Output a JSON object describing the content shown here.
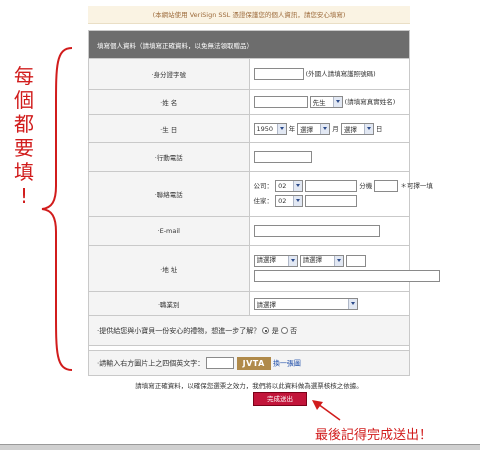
{
  "notice": "(本網站使用 VeriSign SSL 憑證保護您的個人資訊，請您安心填寫)",
  "form": {
    "header": "填寫個人資料（請填寫正確資料，以免無法領取贈品）",
    "id_number": {
      "label": "‧身分證字號",
      "value": "",
      "hint": "(外國人請填寫護照號碼)"
    },
    "name": {
      "label": "‧姓 名",
      "value": "",
      "title_select": "先生",
      "hint": "(請填寫真實姓名)"
    },
    "birthday": {
      "label": "‧生 日",
      "year": "1950",
      "year_unit": "年",
      "month": "選擇",
      "month_unit": "月",
      "day": "選擇",
      "day_unit": "日"
    },
    "mobile": {
      "label": "‧行動電話",
      "value": ""
    },
    "phone": {
      "label": "‧聯絡電話",
      "office_label": "公司：",
      "office_area": "02",
      "office_number": "",
      "ext_label": "分機",
      "ext_value": "",
      "optional_note": "＊可擇一填",
      "home_label": "住家：",
      "home_area": "02",
      "home_number": ""
    },
    "email": {
      "label": "‧E-mail",
      "value": ""
    },
    "address": {
      "label": "‧地 址",
      "city": "請選擇",
      "district": "請選擇",
      "zip": "",
      "street": ""
    },
    "occupation": {
      "label": "‧職業別",
      "value": "請選擇"
    },
    "gift_question": {
      "text": "‧提供給您與小寶貝一份安心的禮物，想進一步了解？",
      "yes": "是",
      "no": "否",
      "selected": "yes"
    },
    "captcha": {
      "label": "‧請輸入右方圖片上之四個英文字：",
      "value": "",
      "image_text": "JVTA",
      "refresh_link": "換一張圖"
    }
  },
  "footer_note": "請填寫正確資料，以確保您選票之效力，我們將以此資料做為選票核核之依據。",
  "submit_label": "完成送出",
  "annotations": {
    "left": "每\n個\n都\n要\n填\n!",
    "bottom": "最後記得完成送出！"
  },
  "colors": {
    "annotation": "#d11c1c",
    "submit": "#c2153a",
    "header": "#6d6d6d",
    "notice_text": "#9c6a3a"
  }
}
